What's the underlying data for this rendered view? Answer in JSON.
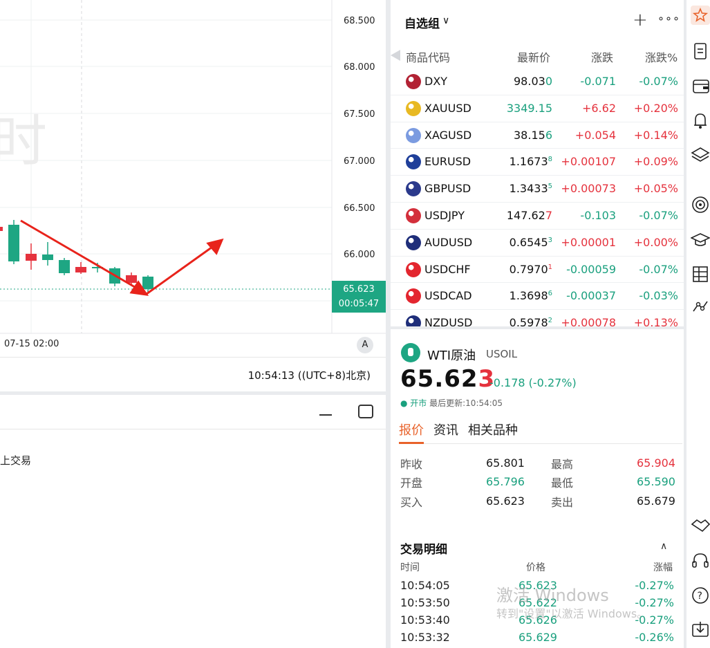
{
  "chart": {
    "y_ticks": [
      "68.500",
      "68.000",
      "67.500",
      "67.000",
      "66.500",
      "66.000"
    ],
    "price_tag": {
      "price": "65.623",
      "countdown": "00:05:47"
    },
    "x_tick": "07-15 02:00",
    "scale_button": "A",
    "watermark_char": "时",
    "clock": "10:54:13 ((UTC+8)北京)",
    "up_color": "#e5323d",
    "down_color": "#1ea683",
    "annotation_color": "#e8231b"
  },
  "bottom_panel": {
    "text": "上交易"
  },
  "watchlist": {
    "title": "自选组",
    "headers": {
      "symbol": "商品代码",
      "price": "最新价",
      "change": "涨跌",
      "percent": "涨跌%"
    },
    "rows": [
      {
        "symbol": "DXY",
        "price_main": "98.03",
        "price_last": "0",
        "price_sup": "",
        "last_dir": "dn",
        "change": "-0.071",
        "percent": "-0.07%",
        "dir": "dn",
        "icon": "us-flag-icon",
        "color": "#b22234"
      },
      {
        "symbol": "XAUUSD",
        "price_main": "3349.15",
        "price_last": "",
        "price_sup": "",
        "last_dir": "dn",
        "change": "+6.62",
        "percent": "+0.20%",
        "dir": "up",
        "icon": "gold-icon",
        "color": "#e8b923",
        "price_color": "dn"
      },
      {
        "symbol": "XAGUSD",
        "price_main": "38.15",
        "price_last": "6",
        "price_sup": "",
        "last_dir": "dn",
        "change": "+0.054",
        "percent": "+0.14%",
        "dir": "up",
        "icon": "silver-icon",
        "color": "#7b9be0"
      },
      {
        "symbol": "EURUSD",
        "price_main": "1.1673",
        "price_last": "",
        "price_sup": "8",
        "last_dir": "dn",
        "change": "+0.00107",
        "percent": "+0.09%",
        "dir": "up",
        "icon": "eu-flag-icon",
        "color": "#1f3f9a"
      },
      {
        "symbol": "GBPUSD",
        "price_main": "1.3433",
        "price_last": "",
        "price_sup": "5",
        "last_dir": "dn",
        "change": "+0.00073",
        "percent": "+0.05%",
        "dir": "up",
        "icon": "uk-flag-icon",
        "color": "#2b3a8c"
      },
      {
        "symbol": "USDJPY",
        "price_main": "147.62",
        "price_last": "7",
        "price_sup": "",
        "last_dir": "up",
        "change": "-0.103",
        "percent": "-0.07%",
        "dir": "dn",
        "icon": "jp-flag-icon",
        "color": "#d32f3b"
      },
      {
        "symbol": "AUDUSD",
        "price_main": "0.6545",
        "price_last": "",
        "price_sup": "3",
        "last_dir": "dn",
        "change": "+0.00001",
        "percent": "+0.00%",
        "dir": "up",
        "icon": "au-flag-icon",
        "color": "#1f2e7a"
      },
      {
        "symbol": "USDCHF",
        "price_main": "0.7970",
        "price_last": "",
        "price_sup": "1",
        "last_dir": "up",
        "change": "-0.00059",
        "percent": "-0.07%",
        "dir": "dn",
        "icon": "ch-flag-icon",
        "color": "#e3262f"
      },
      {
        "symbol": "USDCAD",
        "price_main": "1.3698",
        "price_last": "",
        "price_sup": "6",
        "last_dir": "dn",
        "change": "-0.00037",
        "percent": "-0.03%",
        "dir": "dn",
        "icon": "ca-flag-icon",
        "color": "#e3262f"
      },
      {
        "symbol": "NZDUSD",
        "price_main": "0.5978",
        "price_last": "",
        "price_sup": "2",
        "last_dir": "dn",
        "change": "+0.00078",
        "percent": "+0.13%",
        "dir": "up",
        "icon": "nz-flag-icon",
        "color": "#1f2e7a"
      }
    ]
  },
  "quote": {
    "name": "WTI原油",
    "code": "USOIL",
    "price_main": "65.62",
    "price_last": "3",
    "change": "-0.178 (-0.27%)",
    "status": "● 开市",
    "updated": "最后更新:10:54:05",
    "tabs": [
      "报价",
      "资讯",
      "相关品种"
    ],
    "stats": {
      "prev_close_label": "昨收",
      "prev_close": "65.801",
      "high_label": "最高",
      "high": "65.904",
      "open_label": "开盘",
      "open": "65.796",
      "low_label": "最低",
      "low": "65.590",
      "bid_label": "买入",
      "bid": "65.623",
      "ask_label": "卖出",
      "ask": "65.679"
    },
    "detail_title": "交易明细",
    "detail_headers": {
      "time": "时间",
      "price": "价格",
      "change": "涨幅"
    },
    "trades": [
      {
        "time": "10:54:05",
        "price": "65.623",
        "change": "-0.27%"
      },
      {
        "time": "10:53:50",
        "price": "65.622",
        "change": "-0.27%"
      },
      {
        "time": "10:53:40",
        "price": "65.626",
        "change": "-0.27%"
      },
      {
        "time": "10:53:32",
        "price": "65.629",
        "change": "-0.26%"
      }
    ]
  },
  "os_watermark": {
    "line1": "激活 Windows",
    "line2": "转到\"设置\"以激活 Windows。"
  },
  "right_bar": {
    "icons": [
      "star-icon",
      "document-icon",
      "wallet-icon",
      "bell-icon",
      "layers-icon",
      "target-icon",
      "graduation-cap-icon",
      "building-icon",
      "chart-nodes-icon",
      "handshake-icon",
      "headset-icon",
      "help-icon",
      "download-icon"
    ]
  }
}
